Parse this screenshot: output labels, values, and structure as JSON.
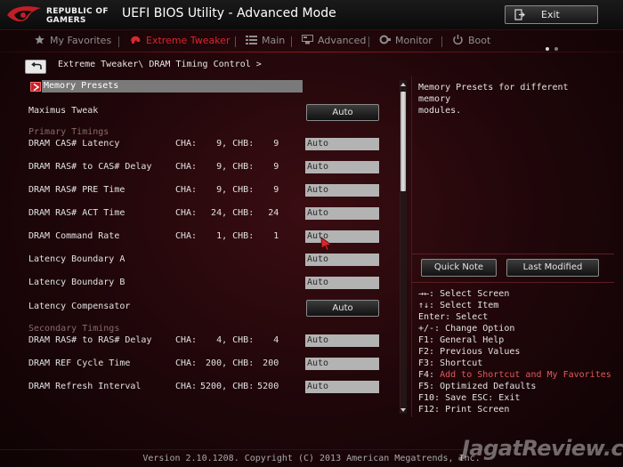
{
  "header": {
    "brand_line1": "REPUBLIC OF",
    "brand_line2": "GAMERS",
    "title": "UEFI BIOS Utility - Advanced Mode",
    "exit_label": "Exit"
  },
  "tabs": [
    {
      "label": "My Favorites",
      "icon": "star-icon",
      "active": false
    },
    {
      "label": "Extreme Tweaker",
      "icon": "tweaker-icon",
      "active": true
    },
    {
      "label": "Main",
      "icon": "list-icon",
      "active": false
    },
    {
      "label": "Advanced",
      "icon": "advanced-icon",
      "active": false
    },
    {
      "label": "Monitor",
      "icon": "monitor-icon",
      "active": false
    },
    {
      "label": "Boot",
      "icon": "power-icon",
      "active": false
    }
  ],
  "breadcrumb": "Extreme Tweaker\\ DRAM Timing Control >",
  "presets_label": "Memory Presets",
  "maximus_tweak": {
    "label": "Maximus Tweak",
    "value": "Auto"
  },
  "primary_timings_label": "Primary Timings",
  "primary_rows": [
    {
      "label": "DRAM CAS# Latency",
      "cha": "9",
      "chb": "9",
      "value": "Auto"
    },
    {
      "label": "DRAM RAS# to CAS# Delay",
      "cha": "9",
      "chb": "9",
      "value": "Auto"
    },
    {
      "label": "DRAM RAS# PRE Time",
      "cha": "9",
      "chb": "9",
      "value": "Auto"
    },
    {
      "label": "DRAM RAS# ACT Time",
      "cha": "24",
      "chb": "24",
      "value": "Auto"
    },
    {
      "label": "DRAM Command Rate",
      "cha": "1",
      "chb": "1",
      "value": "Auto"
    }
  ],
  "latency_boundary_a": {
    "label": "Latency Boundary A",
    "value": "Auto"
  },
  "latency_boundary_b": {
    "label": "Latency Boundary B",
    "value": "Auto"
  },
  "latency_compensator": {
    "label": "Latency Compensator",
    "value": "Auto"
  },
  "secondary_timings_label": "Secondary Timings",
  "secondary_rows": [
    {
      "label": "DRAM RAS# to RAS# Delay",
      "cha": "4",
      "chb": "4",
      "value": "Auto"
    },
    {
      "label": "DRAM REF Cycle Time",
      "cha": "200",
      "chb": "200",
      "value": "Auto"
    },
    {
      "label": "DRAM Refresh Interval",
      "cha": "5200",
      "chb": "5200",
      "value": "Auto"
    }
  ],
  "channel_labels": {
    "a": "CHA:",
    "b": "CHB:"
  },
  "help": {
    "line1": "Memory Presets for different memory",
    "line2": "modules."
  },
  "buttons": {
    "quick_note": "Quick Note",
    "last_modified": "Last Modified"
  },
  "keys": [
    {
      "text": "→←: Select Screen",
      "highlight": false
    },
    {
      "text": "↑↓: Select Item",
      "highlight": false
    },
    {
      "text": "Enter: Select",
      "highlight": false
    },
    {
      "text": "+/-: Change Option",
      "highlight": false
    },
    {
      "text": "F1: General Help",
      "highlight": false
    },
    {
      "text": "F2: Previous Values",
      "highlight": false
    },
    {
      "text": "F3: Shortcut",
      "highlight": false
    },
    {
      "text": "F4: Add to Shortcut and My Favorites",
      "highlight": true
    },
    {
      "text": "F5: Optimized Defaults",
      "highlight": false
    },
    {
      "text": "F10: Save  ESC: Exit",
      "highlight": false
    },
    {
      "text": "F12: Print Screen",
      "highlight": false
    }
  ],
  "footer": "Version 2.10.1208. Copyright (C) 2013 American Megatrends, Inc.",
  "watermark": "JagatReview.com",
  "colors": {
    "accent": "#d9272e",
    "field": "#b3b3b3",
    "background": "#1e0609"
  }
}
